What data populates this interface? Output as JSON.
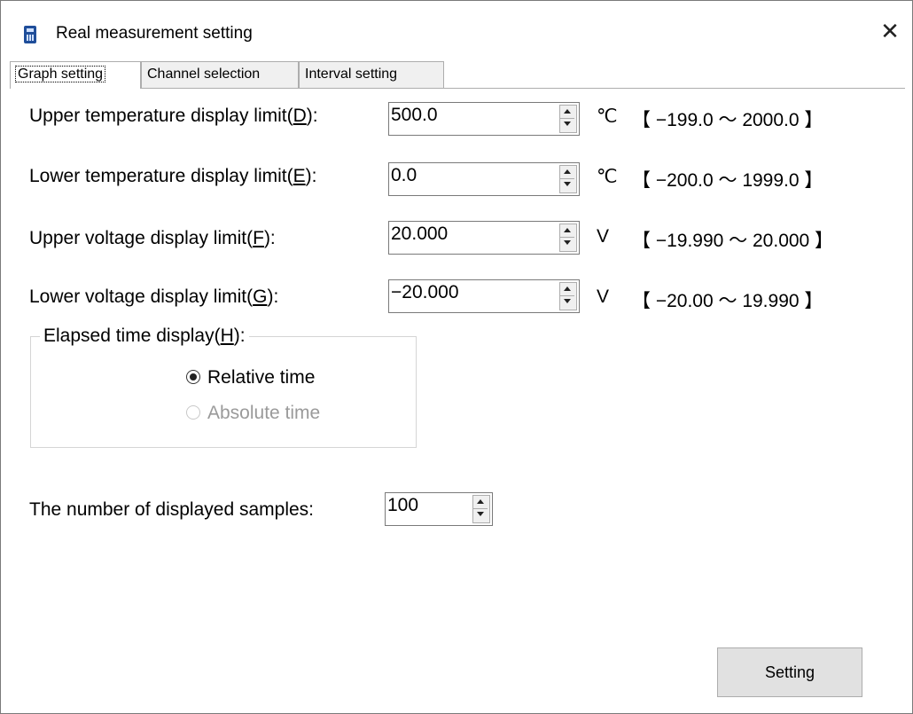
{
  "window": {
    "title": "Real measurement setting",
    "close_glyph": "✕",
    "app_icon": "calculator-icon"
  },
  "tabs": [
    {
      "label": "Graph setting",
      "active": true
    },
    {
      "label": "Channel selection",
      "active": false
    },
    {
      "label": "Interval setting",
      "active": false
    }
  ],
  "fields": [
    {
      "label_pre": "Upper temperature display limit(",
      "mnemonic": "D",
      "label_post": "):",
      "value": "500.0",
      "unit": "℃",
      "range": "【 −199.0 ～ 2000.0 】"
    },
    {
      "label_pre": "Lower temperature display limit(",
      "mnemonic": "E",
      "label_post": "):",
      "value": "0.0",
      "unit": "℃",
      "range": "【 −200.0 ～ 1999.0 】"
    },
    {
      "label_pre": "Upper voltage display limit(",
      "mnemonic": "F",
      "label_post": "):",
      "value": "20.000",
      "unit": "V",
      "range": "【 −19.990 ～ 20.000 】"
    },
    {
      "label_pre": "Lower voltage display limit(",
      "mnemonic": "G",
      "label_post": "):",
      "value": "−20.000",
      "unit": "V",
      "range": "【 −20.00 ～ 19.990 】"
    }
  ],
  "elapsed": {
    "legend_pre": "Elapsed time display(",
    "mnemonic": "H",
    "legend_post": "):",
    "options": [
      {
        "label": "Relative time",
        "selected": true,
        "enabled": true
      },
      {
        "label": "Absolute time",
        "selected": false,
        "enabled": false
      }
    ]
  },
  "samples": {
    "label": "The number of displayed samples:",
    "value": "100"
  },
  "setting_button": "Setting"
}
